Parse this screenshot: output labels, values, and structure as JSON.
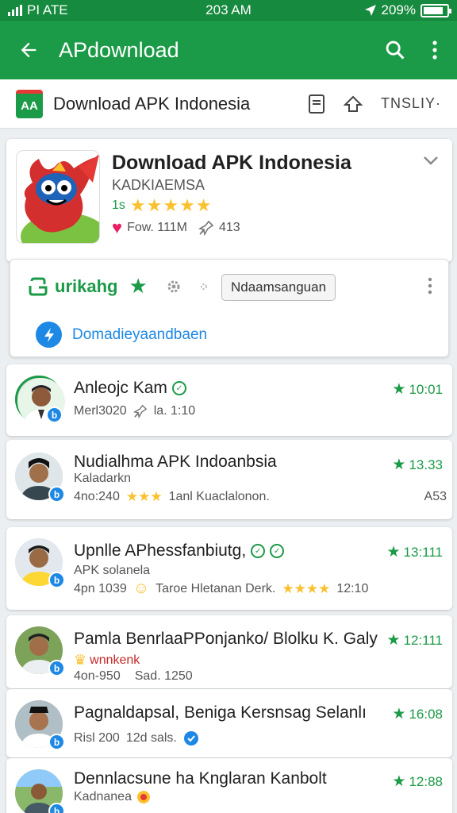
{
  "status_bar": {
    "carrier": "PI ATE",
    "time": "203 AM",
    "battery": "209%",
    "battery_level": 0.85
  },
  "app_bar": {
    "title": "APdownload"
  },
  "sub_header": {
    "logo_text": "AA",
    "title": "Download APK Indonesia",
    "lang": "TNSLIY·"
  },
  "app_card": {
    "name": "Download APK Indonesia",
    "developer": "KADKIAEMSA",
    "rating_label": "1s",
    "stars": "★★★★★",
    "downloads": "Fow. 111M",
    "size": "413"
  },
  "action_panel": {
    "install_label": "urikahg",
    "pill_label": "Ndaamsanguan",
    "download_label": "Domadieyaandbaen"
  },
  "reviews": [
    {
      "name": "Anleojc Kam",
      "meta_a": "Merl3020",
      "meta_b": "la. 1:10",
      "score": "10:01"
    },
    {
      "name": "Nudialhma APK  Indoanbsia",
      "sub": "Kaladarkn",
      "meta_a": "4no:240",
      "stars": "★★★",
      "meta_b": "1anl Kuaclalonon.",
      "meta_c": "A53",
      "score": "13.33"
    },
    {
      "name": "Upnlle APhessfanbiutg,",
      "sub": "APK solanela",
      "meta_a": "4pn 1039",
      "meta_b": "Taroe Hletanan Derk.",
      "stars": "★★★★",
      "meta_c": "12:10",
      "score": "13:111"
    },
    {
      "name": "Pamla BenrlaaPPonjanko/ Blolku K. Galy",
      "sub": "wnnkenk",
      "meta_a": "4on-950",
      "meta_b": "Sad. 1250",
      "score": "12:111"
    },
    {
      "name": "Pagnaldapsal, Beniga Kersnsag Selanlı",
      "meta_a": "Risl 200",
      "meta_b": "12d sals.",
      "score": "16:08"
    },
    {
      "name": "Dennlacsune ha Knglaran Kanbolt",
      "sub": "Kadnanea",
      "score": "12:88"
    }
  ],
  "colors": {
    "primary": "#1b9a47",
    "status": "#168a3e",
    "accent_blue": "#1e88e5",
    "star": "#fbc02d"
  }
}
